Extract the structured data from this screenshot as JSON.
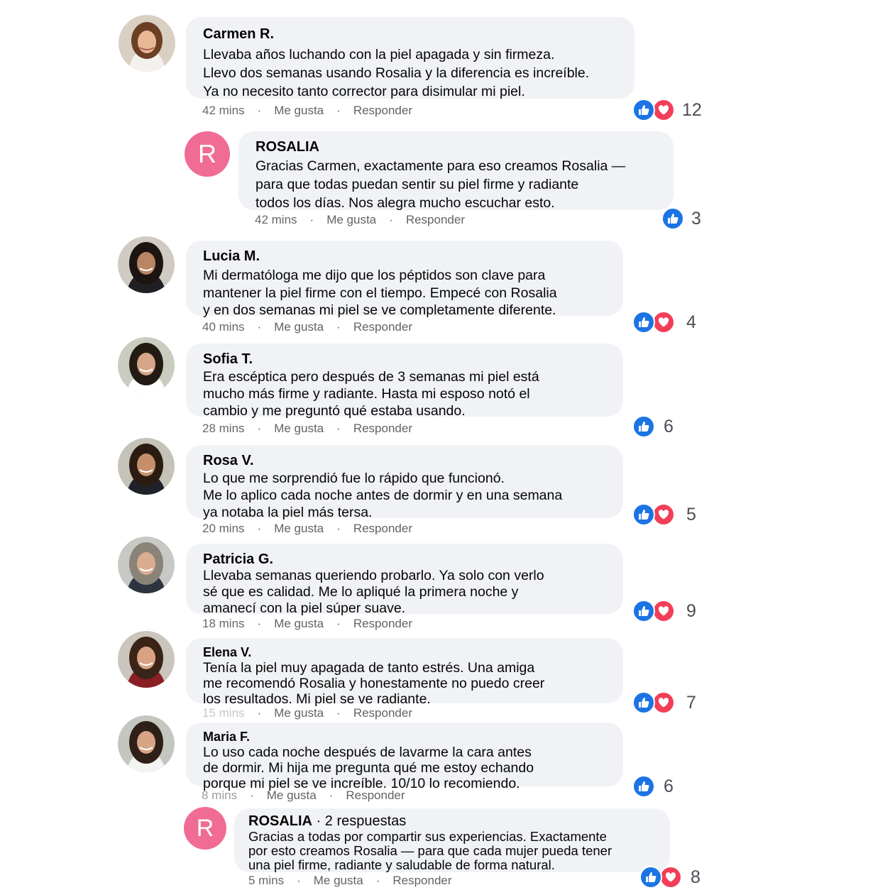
{
  "comments": [
    {
      "author": "Carmen R.",
      "author_suffix": "",
      "text": "Llevaba años luchando con la piel apagada y sin firmeza.\nLlevo dos semanas usando Rosalia y la diferencia es increíble.\nYa no necesito tanto corrector para disimular mi piel.",
      "time": "42 mins",
      "like_label": "Me gusta",
      "reply_label": "Responder",
      "reactions": [
        "like",
        "love"
      ],
      "reaction_count": "12"
    },
    {
      "author": "ROSALIA",
      "author_suffix": "",
      "avatar_letter": "R",
      "text": "Gracias Carmen, exactamente para eso creamos Rosalia —\npara que todas puedan sentir su piel firme y radiante\ntodos los días. Nos alegra mucho escuchar esto.",
      "time": "42 mins",
      "like_label": "Me gusta",
      "reply_label": "Responder",
      "reactions": [
        "like"
      ],
      "reaction_count": "3"
    },
    {
      "author": "Lucia M.",
      "author_suffix": "",
      "text": "Mi dermatóloga me dijo que los péptidos son clave para\nmantener la piel firme con el tiempo. Empecé con Rosalia\ny en dos semanas mi piel se ve completamente diferente.",
      "time": "40 mins",
      "like_label": "Me gusta",
      "reply_label": "Responder",
      "reactions": [
        "like",
        "love"
      ],
      "reaction_count": "4"
    },
    {
      "author": "Sofia T.",
      "author_suffix": "",
      "text": "Era escéptica pero después de 3 semanas mi piel está\nmucho más firme y radiante. Hasta mi esposo notó el\ncambio y me preguntó qué estaba usando.",
      "time": "28 mins",
      "like_label": "Me gusta",
      "reply_label": "Responder",
      "reactions": [
        "like"
      ],
      "reaction_count": "6"
    },
    {
      "author": "Rosa V.",
      "author_suffix": "",
      "text": "Lo que me sorprendió fue lo rápido que funcionó.\nMe lo aplico cada noche antes de dormir y en una semana\nya notaba la piel más tersa.",
      "time": "20 mins",
      "like_label": "Me gusta",
      "reply_label": "Responder",
      "reactions": [
        "like",
        "love"
      ],
      "reaction_count": "5"
    },
    {
      "author": "Patricia G.",
      "author_suffix": "",
      "text": "Llevaba semanas queriendo probarlo. Ya solo con verlo\nsé que es calidad. Me lo apliqué la primera noche y\namanecí con la piel súper suave.",
      "time": "18 mins",
      "like_label": "Me gusta",
      "reply_label": "Responder",
      "reactions": [
        "like",
        "love"
      ],
      "reaction_count": "9"
    },
    {
      "author": "Elena V.",
      "author_suffix": "",
      "text": "Tenía la piel muy apagada de tanto estrés. Una amiga\nme recomendó Rosalia y honestamente no puedo creer\nlos resultados. Mi piel se ve radiante.",
      "time": "15 mins",
      "like_label": "Me gusta",
      "reply_label": "Responder",
      "reactions": [
        "like",
        "love"
      ],
      "reaction_count": "7"
    },
    {
      "author": "Maria F.",
      "author_suffix": "",
      "text": "Lo uso cada noche después de lavarme la cara antes\nde dormir. Mi hija me pregunta qué me estoy echando\nporque mi piel se ve increíble. 10/10 lo recomiendo.",
      "time": "8 mins",
      "like_label": "Me gusta",
      "reply_label": "Responder",
      "reactions": [
        "like"
      ],
      "reaction_count": "6"
    },
    {
      "author": "ROSALIA",
      "author_suffix": " · 2 respuestas",
      "avatar_letter": "R",
      "text": "Gracias a todas por compartir sus experiencias. Exactamente\npor esto creamos Rosalia — para que cada mujer pueda tener\nuna piel firme, radiante y saludable de forma natural.",
      "time": "5 mins",
      "like_label": "Me gusta",
      "reply_label": "Responder",
      "reactions": [
        "like",
        "love"
      ],
      "reaction_count": "8"
    }
  ],
  "colors": {
    "bubble": "#f0f2f5",
    "like": "#1b74e4",
    "love": "#f33e58",
    "brand_avatar": "#f06c95",
    "meta_text": "#65676b"
  }
}
